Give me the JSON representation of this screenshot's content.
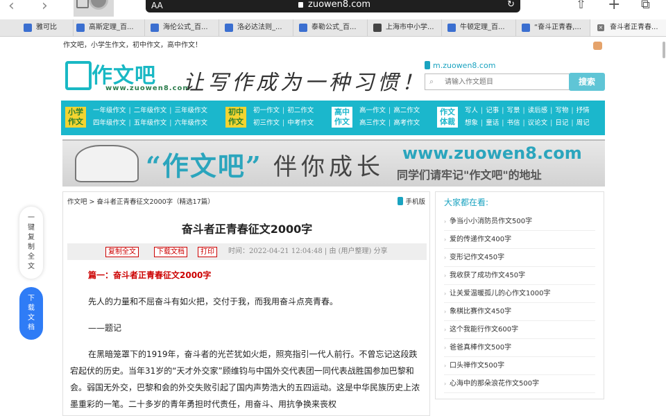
{
  "browser": {
    "address_prefix": "AA",
    "url": "zuowen8.com",
    "icons": {
      "back": "chevron-left-icon",
      "forward": "chevron-right-icon",
      "reload": "reload-icon",
      "share": "share-icon",
      "new_tab": "plus-icon",
      "tabs": "tabs-icon"
    },
    "tabs": [
      {
        "label": "雅可比"
      },
      {
        "label": "高斯定理_百..."
      },
      {
        "label": "海伦公式_百..."
      },
      {
        "label": "洛必达法则_..."
      },
      {
        "label": "泰勒公式_百..."
      },
      {
        "label": "上海市中小学..."
      },
      {
        "label": "牛顿定理_百..."
      },
      {
        "label": "“奋斗正青春,..."
      },
      {
        "label": "奋斗者正青春..."
      }
    ]
  },
  "site": {
    "slogan": "作文吧，小学生作文，初中作文，高中作文！",
    "logo_main": "作文吧",
    "logo_sub": "www.zuowen8.com",
    "hand_slogan": "让写作成为一种习惯！",
    "mobile_url": "m.zuowen8.com",
    "search_placeholder": "请输入作文题目",
    "search_button": "搜索",
    "accent_color": "#1bb7cc",
    "nav": [
      {
        "tag": "小学作文",
        "rows": [
          [
            "一年级作文",
            "二年级作文",
            "三年级作文"
          ],
          [
            "四年级作文",
            "五年级作文",
            "六年级作文"
          ]
        ]
      },
      {
        "tag": "初中作文",
        "rows": [
          [
            "初一作文",
            "初二作文"
          ],
          [
            "初三作文",
            "中考作文"
          ]
        ]
      },
      {
        "tag": "高中作文",
        "rows": [
          [
            "高一作文",
            "高二作文"
          ],
          [
            "高三作文",
            "高考作文"
          ]
        ]
      },
      {
        "tag": "作文体裁",
        "rows": [
          [
            "写人",
            "记事",
            "写景",
            "读后感",
            "写物",
            "抒情"
          ],
          [
            "想象",
            "童话",
            "书信",
            "议论文",
            "日记",
            "周记"
          ]
        ]
      }
    ],
    "banner": {
      "quote": "“作文吧”",
      "text": "伴你成长",
      "url": "www.zuowen8.com",
      "sub": "同学们请牢记\"作文吧\"的地址"
    }
  },
  "float": {
    "copy_label": "一键复制全文",
    "download_label": "下载文档"
  },
  "article": {
    "breadcrumb_home": "作文吧",
    "breadcrumb_current": "奋斗者正青春征文2000字（精选17篇）",
    "mobile_version": "手机版",
    "title": "奋斗者正青春征文2000字",
    "buttons": {
      "copy": "复制全文",
      "download": "下载文档",
      "print": "打印"
    },
    "meta": "时间：2022-04-21 12:04:48 | 由 (用户整理) 分享",
    "section_title": "篇一：奋斗者正青春征文2000字",
    "paragraphs": [
      "先人的力量和不屈奋斗有如火把，交付于我，而我用奋斗点亮青春。",
      "——题记",
      "在黑暗笼罩下的1919年，奋斗者的光芒犹如火炬，照亮指引一代人前行。不曾忘记这段跌宕起伏的历史。当年31岁的“天才外交家”顾维钧与中国外交代表团一同代表战胜国参加巴黎和会。弱国无外交，巴黎和会的外交失败引起了国内声势浩大的五四运动。这是中华民族历史上浓墨重彩的一笔。二十多岁的青年勇担时代责任，用奋斗、用抗争换来丧权"
    ]
  },
  "sidebar": {
    "heading": "大家都在看:",
    "items": [
      "争当小小消防员作文500字",
      "爱的传递作文400字",
      "变形记作文450字",
      "我收获了成功作文450字",
      "让关爱温暖孤儿的心作文1000字",
      "象棋比赛作文450字",
      "这个我能行作文600字",
      "爸爸真棒作文500字",
      "口头禅作文500字",
      "心海中的那朵浪花作文500字"
    ]
  }
}
